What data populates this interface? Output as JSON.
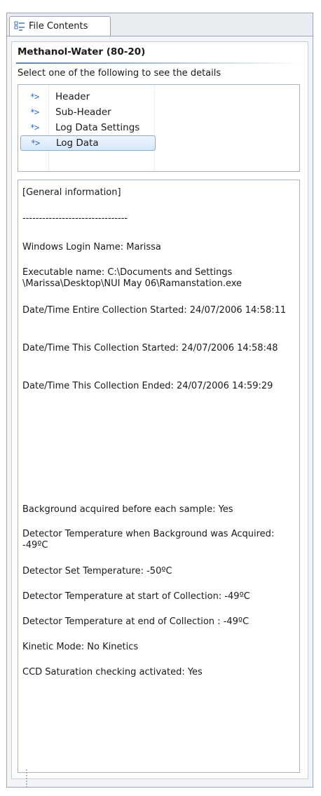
{
  "tab": {
    "label": "File Contents",
    "icon": "file-contents-icon"
  },
  "title": "Methanol-Water (80-20)",
  "instruction": "Select one of the following to see the details",
  "list": {
    "items": [
      {
        "label": "Header",
        "icon": "node-arrow-icon",
        "glyph": "*>",
        "selected": false
      },
      {
        "label": "Sub-Header",
        "icon": "node-arrow-icon",
        "glyph": "*>",
        "selected": false
      },
      {
        "label": "Log Data Settings",
        "icon": "node-arrow-icon",
        "glyph": "*>",
        "selected": false
      },
      {
        "label": "Log Data",
        "icon": "node-arrow-icon",
        "glyph": "*>",
        "selected": true
      }
    ]
  },
  "details": {
    "lines": [
      "[General information]",
      "--------------------------------",
      "Windows Login Name: Marissa",
      "Executable name: C:\\Documents and Settings \\Marissa\\Desktop\\NUI May 06\\Ramanstation.exe",
      "Date/Time Entire Collection Started: 24/07/2006 14:58:11",
      "Date/Time This Collection Started: 24/07/2006 14:58:48",
      "Date/Time This Collection Ended: 24/07/2006 14:59:29",
      "Background acquired before each sample: Yes",
      "Detector Temperature when Background was Acquired: -49ºC",
      "Detector Set Temperature: -50ºC",
      "Detector Temperature at start of Collection: -49ºC",
      "Detector Temperature at end of Collection  : -49ºC",
      "Kinetic Mode: No Kinetics",
      "CCD Saturation checking activated: Yes"
    ]
  },
  "colors": {
    "accent": "#2f6cc0",
    "selection_border": "#84acdd",
    "border": "#9aa6b6"
  }
}
